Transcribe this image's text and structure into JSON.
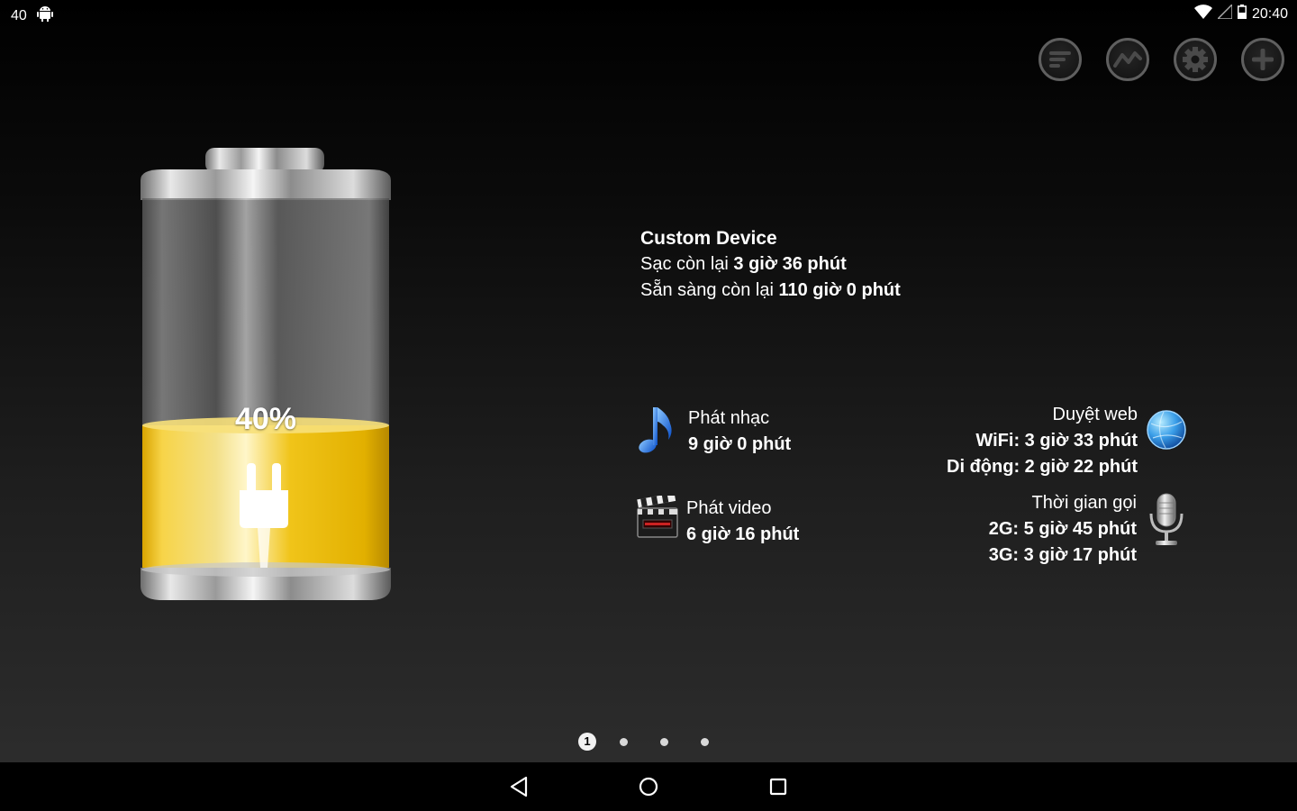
{
  "status_bar": {
    "battery_level": "40",
    "time": "20:40"
  },
  "actions": [
    {
      "name": "list-icon"
    },
    {
      "name": "chart-icon"
    },
    {
      "name": "gear-icon"
    },
    {
      "name": "plus-icon"
    }
  ],
  "battery": {
    "percent_label": "40%",
    "level": 0.4,
    "fill_color": "#f0c419",
    "charging": true
  },
  "device": {
    "name": "Custom Device",
    "charge_prefix": "Sạc còn lại ",
    "charge_value": "3 giờ 36 phút",
    "standby_prefix": "Sẵn sàng còn lại ",
    "standby_value": "110 giờ 0 phút"
  },
  "usage": {
    "music": {
      "label": "Phát nhạc",
      "value": "9 giờ 0 phút"
    },
    "video": {
      "label": "Phát video",
      "value": "6 giờ 16 phút"
    },
    "web": {
      "label": "Duyệt web",
      "wifi": "WiFi: 3 giờ 33 phút",
      "mobile": "Di động: 2 giờ 22 phút"
    },
    "call": {
      "label": "Thời gian gọi",
      "g2": "2G: 5 giờ 45 phút",
      "g3": "3G: 3 giờ 17 phút"
    }
  },
  "pager": {
    "current": "1",
    "total_pages": 4
  }
}
